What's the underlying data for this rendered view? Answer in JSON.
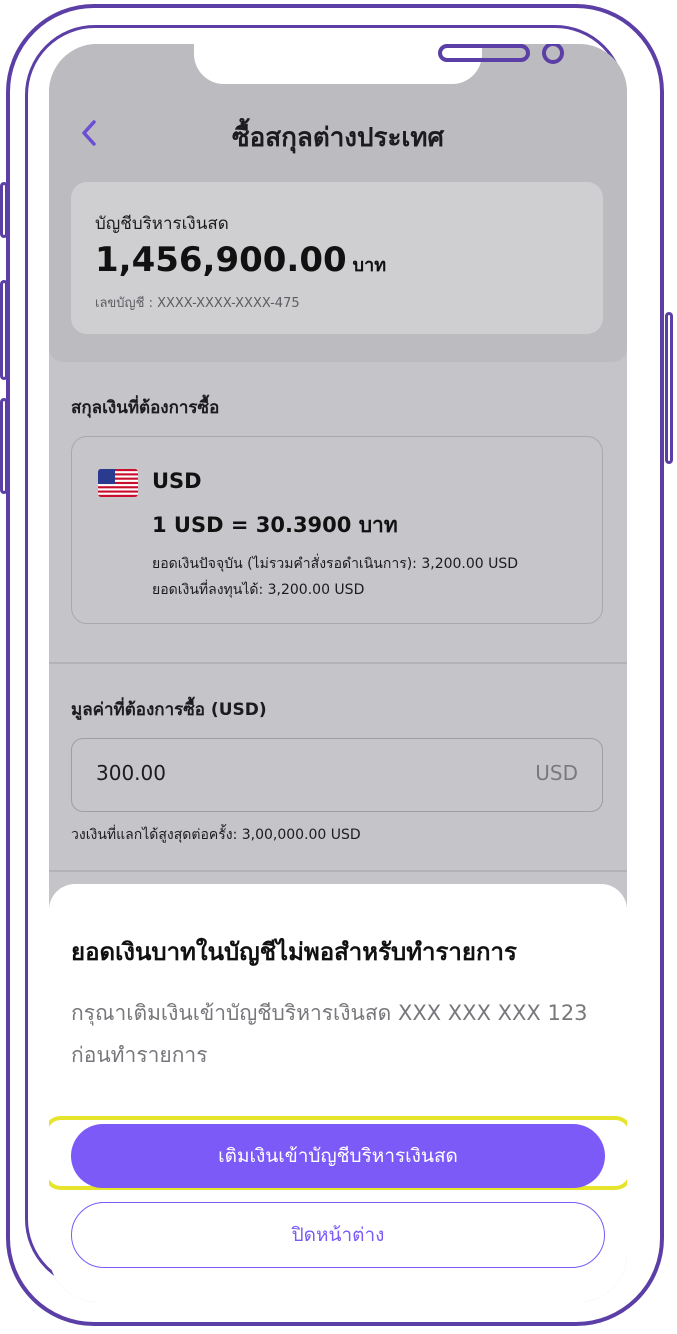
{
  "header": {
    "back_icon": "chevron-left-icon",
    "title": "ซื้อสกุลต่างประเทศ"
  },
  "account": {
    "name": "บัญชีบริหารเงินสด",
    "balance": "1,456,900.00",
    "unit": "บาท",
    "number": "เลขบัญชี : XXXX-XXXX-XXXX-475"
  },
  "currency_section": {
    "label": "สกุลเงินที่ต้องการซื้อ",
    "flag_icon": "us-flag-icon",
    "code": "USD",
    "rate": "1 USD = 30.3900 บาท",
    "current_balance": "ยอดเงินปัจจุบัน (ไม่รวมคำสั่งรอดำเนินการ): 3,200.00 USD",
    "investable_balance": "ยอดเงินที่ลงทุนได้: 3,200.00 USD"
  },
  "amount_section": {
    "label": "มูลค่าที่ต้องการซื้อ (USD)",
    "value": "300.00",
    "unit": "USD",
    "limit": "วงเงินที่แลกได้สูงสุดต่อครั้ง: 3,00,000.00 USD"
  },
  "sheet": {
    "title": "ยอดเงินบาทในบัญชีไม่พอสำหรับทำรายการ",
    "body": "กรุณาเติมเงินเข้าบัญชีบริหารเงินสด XXX XXX XXX 123 ก่อนทำรายการ",
    "primary_button": "เติมเงินเข้าบัญชีบริหารเงินสด",
    "secondary_button": "ปิดหน้าต่าง"
  },
  "colors": {
    "accent": "#7b5af7",
    "frame": "#5b3fa6",
    "highlight": "#e6e52c"
  }
}
